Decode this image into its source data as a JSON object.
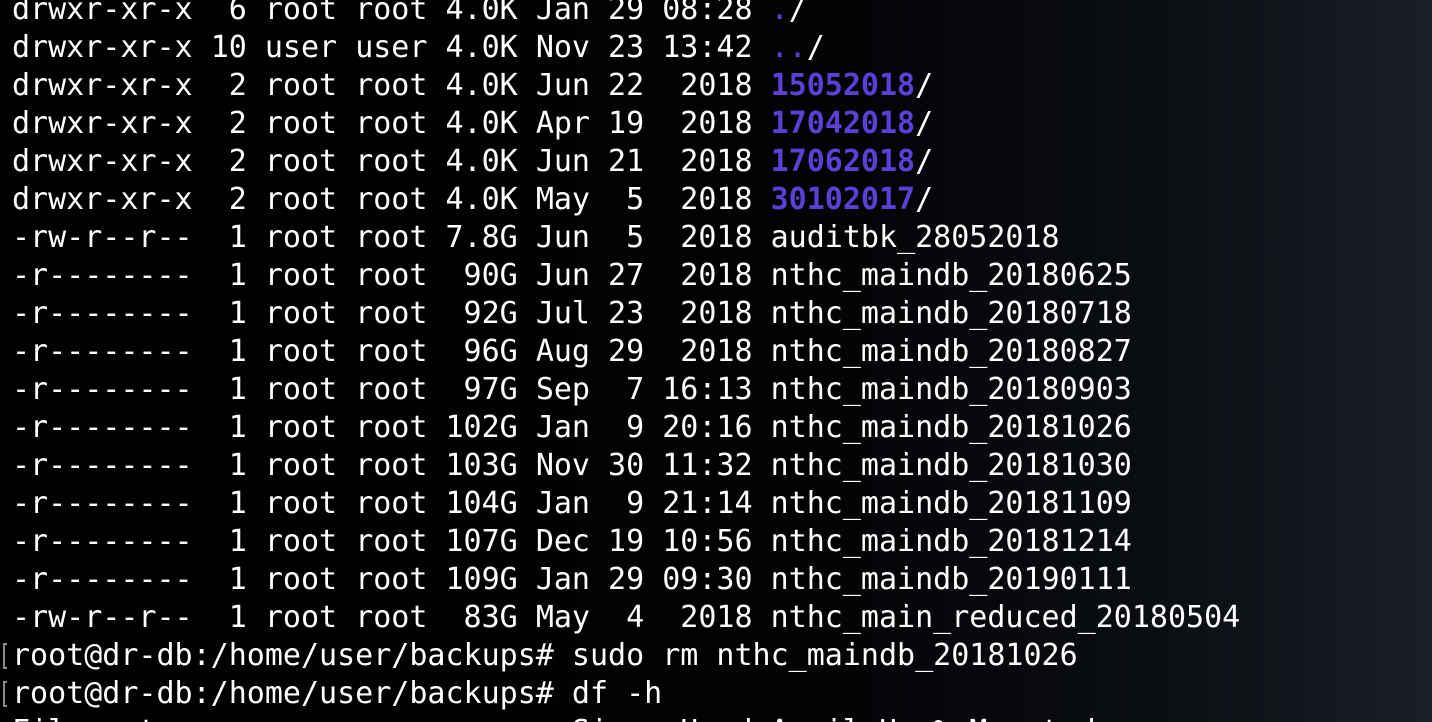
{
  "terminal": {
    "colors": {
      "background": "#000000",
      "text": "#ffffff",
      "directory": "#5b3fd6"
    },
    "listing": [
      {
        "perms": "drwxr-xr-x",
        "links": " 6",
        "owner": "root",
        "group": "root",
        "size": "4.0K",
        "date": "Jan 29 08:28",
        "name": ".",
        "is_dir": true,
        "suffix": "/"
      },
      {
        "perms": "drwxr-xr-x",
        "links": "10",
        "owner": "user",
        "group": "user",
        "size": "4.0K",
        "date": "Nov 23 13:42",
        "name": "..",
        "is_dir": true,
        "suffix": "/"
      },
      {
        "perms": "drwxr-xr-x",
        "links": " 2",
        "owner": "root",
        "group": "root",
        "size": "4.0K",
        "date": "Jun 22  2018",
        "name": "15052018",
        "is_dir": true,
        "suffix": "/"
      },
      {
        "perms": "drwxr-xr-x",
        "links": " 2",
        "owner": "root",
        "group": "root",
        "size": "4.0K",
        "date": "Apr 19  2018",
        "name": "17042018",
        "is_dir": true,
        "suffix": "/"
      },
      {
        "perms": "drwxr-xr-x",
        "links": " 2",
        "owner": "root",
        "group": "root",
        "size": "4.0K",
        "date": "Jun 21  2018",
        "name": "17062018",
        "is_dir": true,
        "suffix": "/"
      },
      {
        "perms": "drwxr-xr-x",
        "links": " 2",
        "owner": "root",
        "group": "root",
        "size": "4.0K",
        "date": "May  5  2018",
        "name": "30102017",
        "is_dir": true,
        "suffix": "/"
      },
      {
        "perms": "-rw-r--r--",
        "links": " 1",
        "owner": "root",
        "group": "root",
        "size": "7.8G",
        "date": "Jun  5  2018",
        "name": "auditbk_28052018",
        "is_dir": false,
        "suffix": ""
      },
      {
        "perms": "-r--------",
        "links": " 1",
        "owner": "root",
        "group": "root",
        "size": " 90G",
        "date": "Jun 27  2018",
        "name": "nthc_maindb_20180625",
        "is_dir": false,
        "suffix": ""
      },
      {
        "perms": "-r--------",
        "links": " 1",
        "owner": "root",
        "group": "root",
        "size": " 92G",
        "date": "Jul 23  2018",
        "name": "nthc_maindb_20180718",
        "is_dir": false,
        "suffix": ""
      },
      {
        "perms": "-r--------",
        "links": " 1",
        "owner": "root",
        "group": "root",
        "size": " 96G",
        "date": "Aug 29  2018",
        "name": "nthc_maindb_20180827",
        "is_dir": false,
        "suffix": ""
      },
      {
        "perms": "-r--------",
        "links": " 1",
        "owner": "root",
        "group": "root",
        "size": " 97G",
        "date": "Sep  7 16:13",
        "name": "nthc_maindb_20180903",
        "is_dir": false,
        "suffix": ""
      },
      {
        "perms": "-r--------",
        "links": " 1",
        "owner": "root",
        "group": "root",
        "size": "102G",
        "date": "Jan  9 20:16",
        "name": "nthc_maindb_20181026",
        "is_dir": false,
        "suffix": ""
      },
      {
        "perms": "-r--------",
        "links": " 1",
        "owner": "root",
        "group": "root",
        "size": "103G",
        "date": "Nov 30 11:32",
        "name": "nthc_maindb_20181030",
        "is_dir": false,
        "suffix": ""
      },
      {
        "perms": "-r--------",
        "links": " 1",
        "owner": "root",
        "group": "root",
        "size": "104G",
        "date": "Jan  9 21:14",
        "name": "nthc_maindb_20181109",
        "is_dir": false,
        "suffix": ""
      },
      {
        "perms": "-r--------",
        "links": " 1",
        "owner": "root",
        "group": "root",
        "size": "107G",
        "date": "Dec 19 10:56",
        "name": "nthc_maindb_20181214",
        "is_dir": false,
        "suffix": ""
      },
      {
        "perms": "-r--------",
        "links": " 1",
        "owner": "root",
        "group": "root",
        "size": "109G",
        "date": "Jan 29 09:30",
        "name": "nthc_maindb_20190111",
        "is_dir": false,
        "suffix": ""
      },
      {
        "perms": "-rw-r--r--",
        "links": " 1",
        "owner": "root",
        "group": "root",
        "size": " 83G",
        "date": "May  4  2018",
        "name": "nthc_main_reduced_20180504",
        "is_dir": false,
        "suffix": ""
      }
    ],
    "prompts": [
      {
        "prompt": "root@dr-db:/home/user/backups# ",
        "command": "sudo rm nthc_maindb_20181026"
      },
      {
        "prompt": "root@dr-db:/home/user/backups# ",
        "command": "df -h"
      }
    ],
    "partial_line": "Filesystem                     Size  Used Avail Use% Mounted on"
  }
}
